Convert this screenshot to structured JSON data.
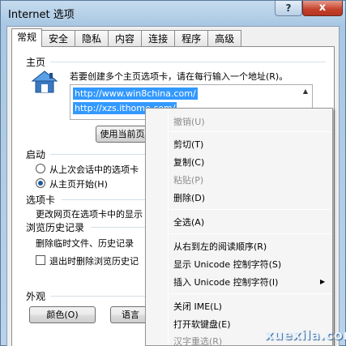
{
  "window": {
    "title": "Internet 选项",
    "help": "?",
    "close": "x"
  },
  "tabs": [
    "常规",
    "安全",
    "隐私",
    "内容",
    "连接",
    "程序",
    "高级"
  ],
  "home": {
    "group": "主页",
    "instruction": "若要创建多个主页选项卡，请在每行输入一个地址(R)。",
    "urls": [
      "http://www.win8china.com/",
      "http://xzs.ithome.com/"
    ],
    "use_current": "使用当前页"
  },
  "startup": {
    "group": "启动",
    "option1": "从上次会话中的选项卡",
    "option2": "从主页开始(H)"
  },
  "tabsgroup": {
    "group": "选项卡",
    "text": "更改网页在选项卡中的显示"
  },
  "history": {
    "group": "浏览历史记录",
    "text": "删除临时文件、历史记录",
    "checkbox": "退出时删除浏览历史记"
  },
  "appearance": {
    "group": "外观",
    "colors": "颜色(O)",
    "languages": "语言"
  },
  "context_menu": {
    "undo": "撤销(U)",
    "cut": "剪切(T)",
    "copy": "复制(C)",
    "paste": "粘贴(P)",
    "delete": "删除(D)",
    "select_all": "全选(A)",
    "rtl": "从右到左的阅读顺序(R)",
    "show_unicode": "显示 Unicode 控制字符(S)",
    "insert_unicode": "插入 Unicode 控制字符(I)",
    "close_ime": "关闭 IME(L)",
    "soft_keyboard": "打开软键盘(E)",
    "reconversion": "汉字重选(R)"
  },
  "watermark": "xuexila.com"
}
